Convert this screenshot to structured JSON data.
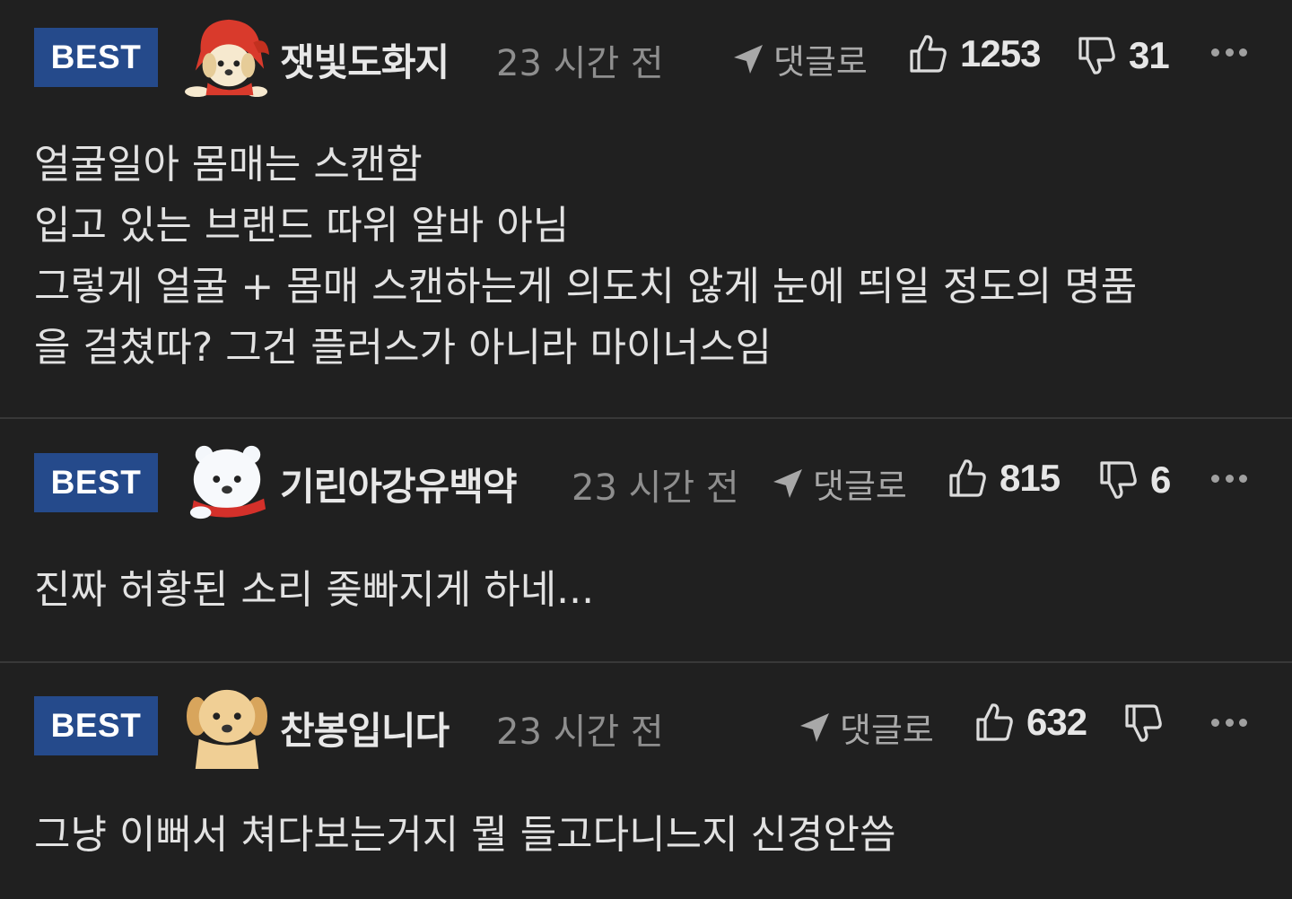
{
  "comments": [
    {
      "badge": "BEST",
      "avatar": "puppy-red-hood-icon",
      "username": "잿빛도화지",
      "time": "23 시간 전",
      "reply_label": "댓글로",
      "likes": "1253",
      "dislikes": "31",
      "body": [
        "얼굴일아 몸매는 스캔함",
        "입고 있는 브랜드 따위 알바 아님",
        "그렇게 얼굴 + 몸매 스캔하는게 의도치 않게 눈에 띄일 정도의 명품",
        "을 걸쳤따? 그건 플러스가 아니라 마이너스임"
      ]
    },
    {
      "badge": "BEST",
      "avatar": "polar-bear-scarf-icon",
      "username": "기린아강유백약",
      "time": "23 시간 전",
      "reply_label": "댓글로",
      "likes": "815",
      "dislikes": "6",
      "body": [
        "진짜 허황된 소리 좆빠지게 하네..."
      ]
    },
    {
      "badge": "BEST",
      "avatar": "puppy-icon",
      "username": "찬봉입니다",
      "time": "23 시간 전",
      "reply_label": "댓글로",
      "likes": "632",
      "dislikes": "",
      "body": [
        "그냥 이뻐서 쳐다보는거지 뭘 들고다니느지 신경안씀"
      ]
    }
  ],
  "colors": {
    "background": "#202020",
    "badge": "#254a8b",
    "muted_text": "#8e8e8e"
  }
}
